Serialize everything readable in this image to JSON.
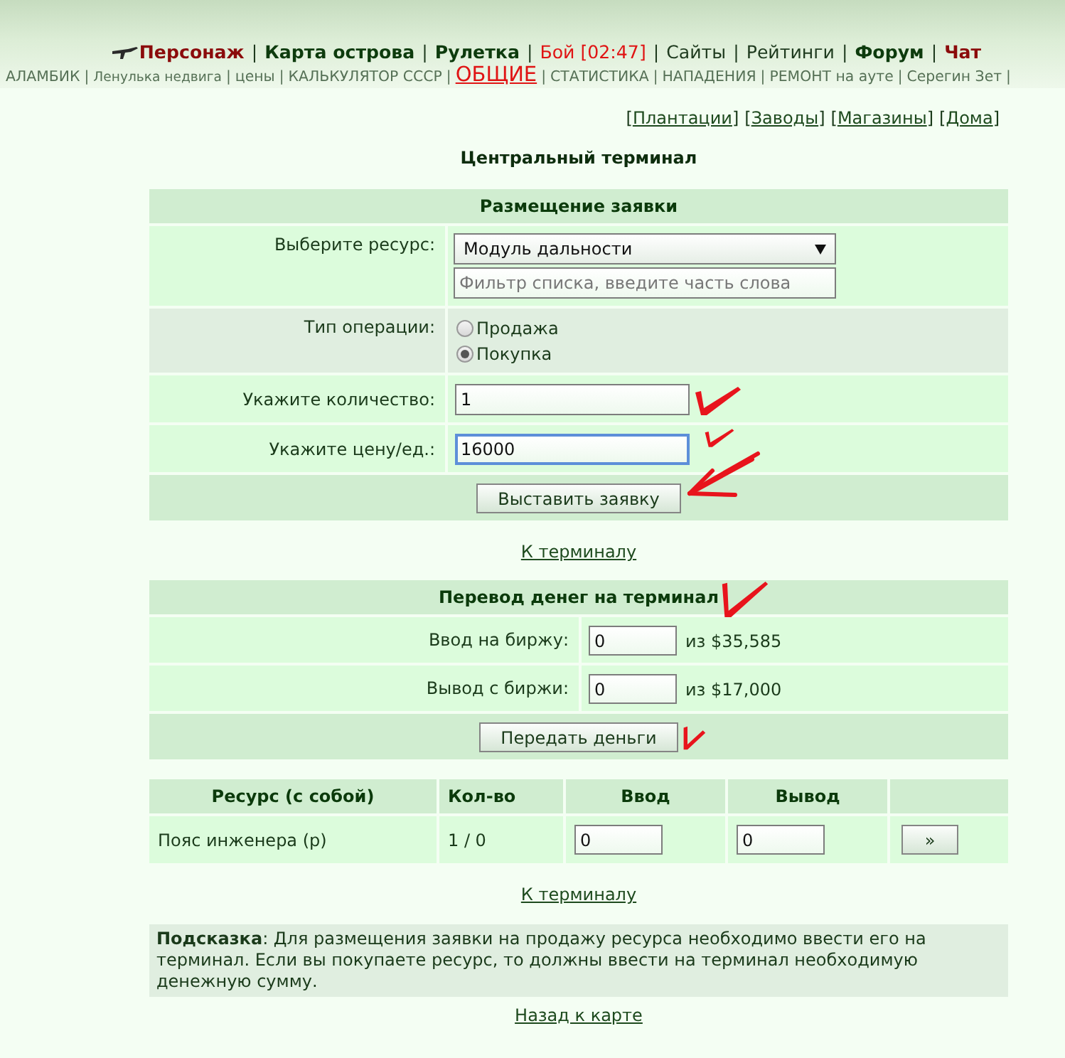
{
  "top_nav": {
    "separator": "|",
    "items": [
      {
        "label": "Персонаж",
        "color": "#8b0b0b",
        "bold": true
      },
      {
        "label": "Карта острова",
        "color": "#0d3b0d",
        "bold": true
      },
      {
        "label": "Рулетка",
        "color": "#0d3b0d",
        "bold": true
      },
      {
        "label": "Бой [02:47]",
        "color": "#e01414",
        "bold": false
      },
      {
        "label": "Сайты",
        "color": "#1e3a1e",
        "bold": false
      },
      {
        "label": "Рейтинги",
        "color": "#1e3a1e",
        "bold": false
      },
      {
        "label": "Форум",
        "color": "#0d3b0d",
        "bold": true
      },
      {
        "label": "Чат",
        "color": "#8b0b0b",
        "bold": true
      }
    ]
  },
  "sub_nav": {
    "separator": "|",
    "trailing_separator": true,
    "items": [
      {
        "label": "АЛАМБИК",
        "kind": "normal"
      },
      {
        "label": "Ленулька недвига",
        "kind": "small"
      },
      {
        "label": "цены",
        "kind": "normal"
      },
      {
        "label": "КАЛЬКУЛЯТОР СССР",
        "kind": "normal"
      },
      {
        "label": "ОБЩИЕ",
        "kind": "highlight"
      },
      {
        "label": "СТАТИСТИКА",
        "kind": "normal"
      },
      {
        "label": "НАПАДЕНИЯ",
        "kind": "normal"
      },
      {
        "label": "РЕМОНТ на ауте",
        "kind": "normal"
      },
      {
        "label": "Серегин Зет",
        "kind": "normal"
      }
    ]
  },
  "section_links": {
    "open": "[",
    "close": "]",
    "items": [
      {
        "label": "Плантации"
      },
      {
        "label": "Заводы"
      },
      {
        "label": "Магазины"
      },
      {
        "label": "Дома"
      }
    ]
  },
  "title": "Центральный терминал",
  "order_panel": {
    "header": "Размещение заявки",
    "rows": [
      {
        "kind": "select",
        "label": "Выберите ресурс:",
        "value": "Модуль дальности",
        "filter_placeholder": "Фильтр списка, введите часть слова"
      },
      {
        "kind": "radio",
        "label": "Тип операции:",
        "options": [
          {
            "label": "Продажа",
            "selected": false
          },
          {
            "label": "Покупка",
            "selected": true
          }
        ]
      },
      {
        "kind": "input",
        "label": "Укажите количество:",
        "value": "1",
        "focused": false,
        "marked": true
      },
      {
        "kind": "input",
        "label": "Укажите цену/ед.:",
        "value": "16000",
        "focused": true,
        "marked": true
      }
    ],
    "button": "Выставить заявку",
    "button_marked": true
  },
  "terminal_link_top": "К терминалу",
  "money_panel": {
    "header": "Перевод денег на терминал",
    "header_marked": true,
    "rows": [
      {
        "label": "Ввод на биржу:",
        "value": "0",
        "limit": "из $35,585"
      },
      {
        "label": "Вывод с биржи:",
        "value": "0",
        "limit": "из $17,000"
      }
    ],
    "button": "Передать деньги",
    "button_marked": true
  },
  "resources_table": {
    "columns": [
      "Ресурс (с собой)",
      "Кол-во",
      "Ввод",
      "Вывод"
    ],
    "rows": [
      {
        "resource": "Пояс инженера (р)",
        "count": "1 / 0",
        "deposit": "0",
        "withdraw": "0",
        "action": "»"
      }
    ]
  },
  "terminal_link_bottom": "К терминалу",
  "hint": "**Подсказка**: Для размещения заявки на продажу ресурса необходимо ввести его на терминал. Если вы покупаете ресурс, то должны ввести на терминал необходимую денежную сумму.",
  "back_link": "Назад к карте"
}
